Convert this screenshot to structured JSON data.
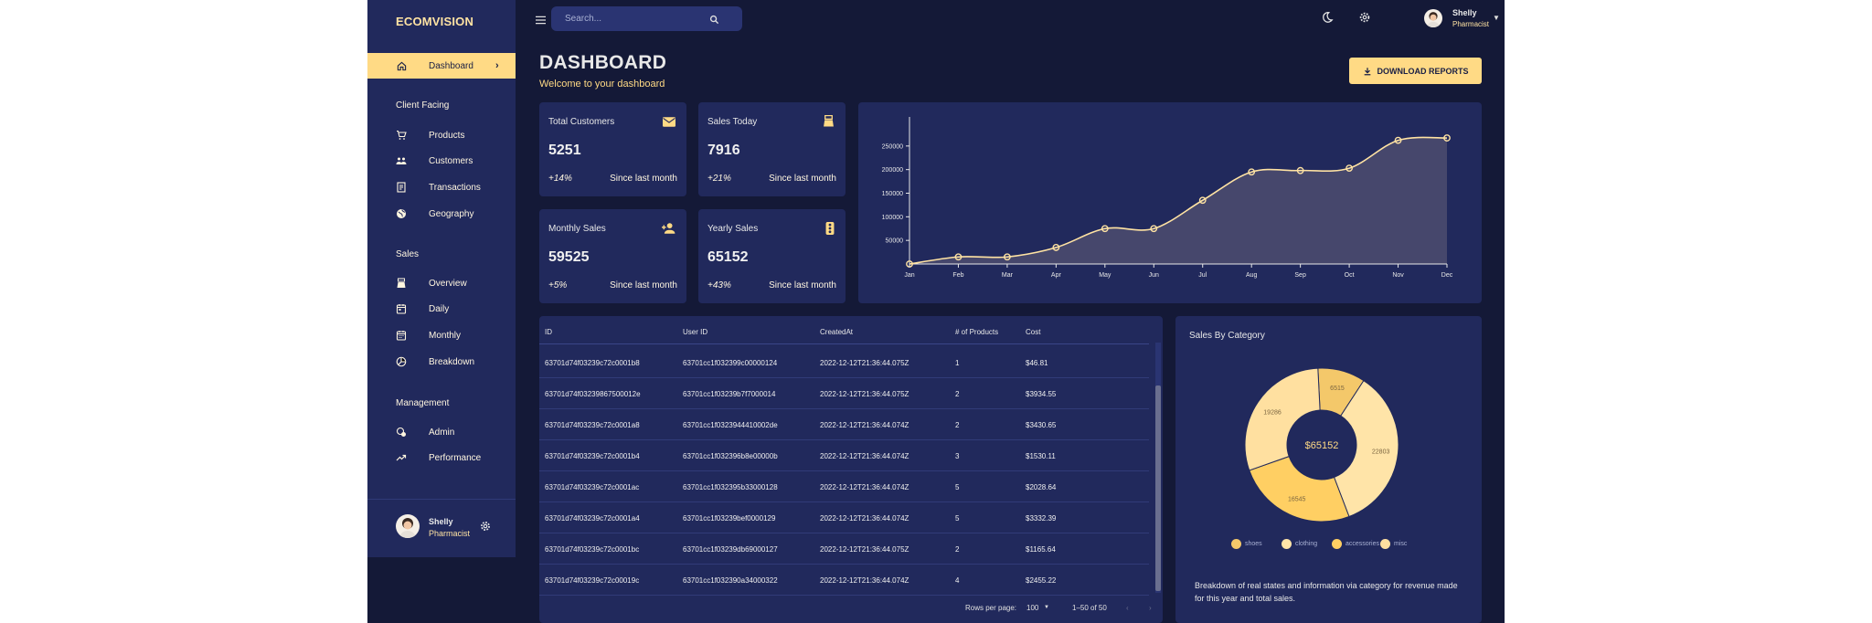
{
  "brand": "ECOMVISION",
  "sidebar": {
    "dashboard_label": "Dashboard",
    "sections": {
      "client_facing": "Client Facing",
      "sales": "Sales",
      "management": "Management"
    },
    "items": [
      "Products",
      "Customers",
      "Transactions",
      "Geography",
      "Overview",
      "Daily",
      "Monthly",
      "Breakdown",
      "Admin",
      "Performance"
    ],
    "user": {
      "name": "Shelly",
      "role": "Pharmacist"
    }
  },
  "topbar": {
    "search_placeholder": "Search...",
    "user": {
      "name": "Shelly",
      "role": "Pharmacist"
    }
  },
  "header": {
    "title": "DASHBOARD",
    "subtitle": "Welcome to your dashboard",
    "download_label": "DOWNLOAD REPORTS"
  },
  "stats": [
    {
      "title": "Total Customers",
      "value": "5251",
      "change": "+14%",
      "since": "Since last month",
      "icon": "email-icon"
    },
    {
      "title": "Sales Today",
      "value": "7916",
      "change": "+21%",
      "since": "Since last month",
      "icon": "point-of-sale-icon"
    },
    {
      "title": "Monthly Sales",
      "value": "59525",
      "change": "+5%",
      "since": "Since last month",
      "icon": "person-add-icon"
    },
    {
      "title": "Yearly Sales",
      "value": "65152",
      "change": "+43%",
      "since": "Since last month",
      "icon": "traffic-icon"
    }
  ],
  "colors": {
    "accent": "#ffda85",
    "panel": "#21295c",
    "bg": "#141937",
    "line": "#ffe3a3",
    "area": "#4a4a6e"
  },
  "chart_data": {
    "type": "area",
    "x": [
      "Jan",
      "Feb",
      "Mar",
      "Apr",
      "May",
      "Jun",
      "Jul",
      "Aug",
      "Sep",
      "Oct",
      "Nov",
      "Dec"
    ],
    "y_ticks": [
      "50000",
      "100000",
      "150000",
      "200000",
      "250000"
    ],
    "ylim": [
      0,
      300000
    ],
    "values": [
      0,
      15000,
      15000,
      35000,
      75000,
      75000,
      135000,
      195000,
      198000,
      203000,
      262000,
      267000
    ],
    "grid": false
  },
  "table": {
    "columns": [
      "ID",
      "User ID",
      "CreatedAt",
      "# of Products",
      "Cost"
    ],
    "rows": [
      [
        "63701d74f03239c72c0001b8",
        "63701cc1f032399c00000124",
        "2022-12-12T21:36:44.075Z",
        "1",
        "$46.81"
      ],
      [
        "63701d74f03239867500012e",
        "63701cc1f03239b7f7000014",
        "2022-12-12T21:36:44.075Z",
        "2",
        "$3934.55"
      ],
      [
        "63701d74f03239c72c0001a8",
        "63701cc1f0323944410002de",
        "2022-12-12T21:36:44.074Z",
        "2",
        "$3430.65"
      ],
      [
        "63701d74f03239c72c0001b4",
        "63701cc1f032396b8e00000b",
        "2022-12-12T21:36:44.074Z",
        "3",
        "$1530.11"
      ],
      [
        "63701d74f03239c72c0001ac",
        "63701cc1f032395b33000128",
        "2022-12-12T21:36:44.074Z",
        "5",
        "$2028.64"
      ],
      [
        "63701d74f03239c72c0001a4",
        "63701cc1f03239bef0000129",
        "2022-12-12T21:36:44.074Z",
        "5",
        "$3332.39"
      ],
      [
        "63701d74f03239c72c0001bc",
        "63701cc1f03239db69000127",
        "2022-12-12T21:36:44.075Z",
        "2",
        "$1165.64"
      ],
      [
        "63701d74f03239c72c00019c",
        "63701cc1f032390a34000322",
        "2022-12-12T21:36:44.074Z",
        "4",
        "$2455.22"
      ]
    ],
    "rows_per_page_label": "Rows per page:",
    "rows_per_page": "100",
    "pagination": "1–50 of 50"
  },
  "pie": {
    "title": "Sales By Category",
    "center": "$65152",
    "slices": [
      {
        "name": "shoes",
        "value": 6515,
        "color": "#f4c86a"
      },
      {
        "name": "clothing",
        "value": 22803,
        "color": "#ffe4a8"
      },
      {
        "name": "accessories",
        "value": 16545,
        "color": "#ffcf63"
      },
      {
        "name": "misc",
        "value": 19286,
        "color": "#ffe0a0"
      }
    ],
    "description": "Breakdown of real states and information via category for revenue made for this year and total sales."
  }
}
